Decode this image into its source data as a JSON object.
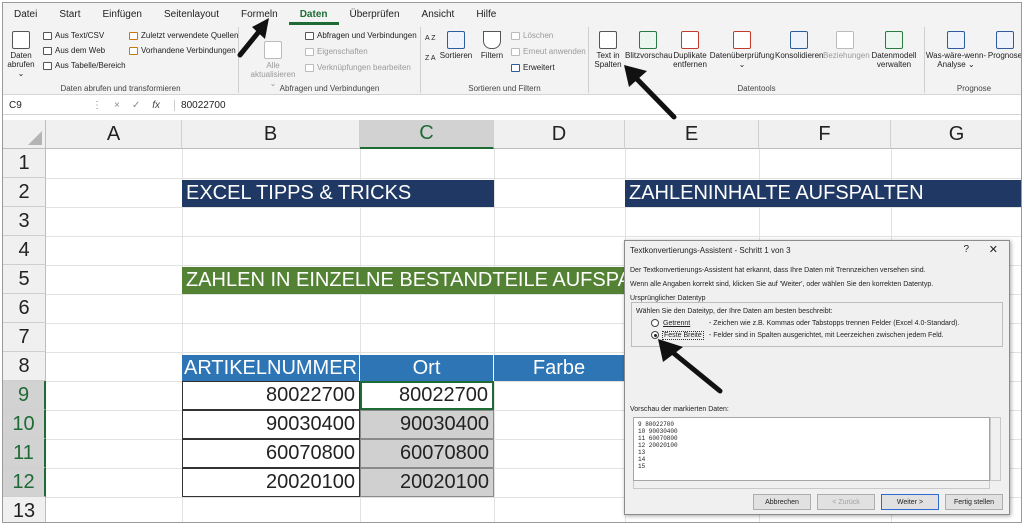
{
  "tabs": [
    "Datei",
    "Start",
    "Einfügen",
    "Seitenlayout",
    "Formeln",
    "Daten",
    "Überprüfen",
    "Ansicht",
    "Hilfe"
  ],
  "active_tab": "Daten",
  "ribbon": {
    "group1": {
      "big_btn_1": "Daten",
      "big_btn_2": "abrufen ⌄",
      "items": [
        "Aus Text/CSV",
        "Aus dem Web",
        "Aus Tabelle/Bereich"
      ],
      "items2": [
        "Zuletzt verwendete Quellen",
        "Vorhandene Verbindungen"
      ],
      "label": "Daten abrufen und transformieren"
    },
    "group2": {
      "big_btn_1": "Alle",
      "big_btn_2": "aktualisieren ⌄",
      "items": [
        "Abfragen und Verbindungen",
        "Eigenschaften",
        "Verknüpfungen bearbeiten"
      ],
      "label": "Abfragen und Verbindungen"
    },
    "group3": {
      "sort_az": "A Z",
      "sort_za": "Z A",
      "sort_btn": "Sortieren",
      "filter_btn": "Filtern",
      "items": [
        "Löschen",
        "Erneut anwenden",
        "Erweitert"
      ],
      "label": "Sortieren und Filtern"
    },
    "group4": {
      "text_in_1": "Text in",
      "text_in_2": "Spalten",
      "blitz": "Blitzvorschau",
      "dup_1": "Duplikate",
      "dup_2": "entfernen",
      "valid_1": "Datenüberprüfung",
      "valid_2": "⌄",
      "konsol": "Konsolidieren",
      "bezieh": "Beziehungen",
      "model_1": "Datenmodell",
      "model_2": "verwalten",
      "label": "Datentools"
    },
    "group5": {
      "wasw_1": "Was-wäre-wenn-",
      "wasw_2": "Analyse ⌄",
      "prog": "Prognose",
      "label": "Prognose"
    }
  },
  "formula_bar": {
    "name_box": "C9",
    "ctrl_more": "⋮",
    "ctrl_cancel": "×",
    "ctrl_enter": "✓",
    "ctrl_fx": "fx",
    "value": "80022700"
  },
  "sheet": {
    "columns": [
      "A",
      "B",
      "C",
      "D",
      "E",
      "F",
      "G"
    ],
    "rows": [
      "1",
      "2",
      "3",
      "4",
      "5",
      "6",
      "7",
      "8",
      "9",
      "10",
      "11",
      "12",
      "13"
    ],
    "banner_b2": "EXCEL TIPPS & TRICKS",
    "banner_e2": "ZAHLENINHALTE AUFSPALTEN",
    "banner_b5": "ZAHLEN IN EINZELNE BESTANDTEILE AUFSPAL",
    "header_b8": "ARTIKELNUMMER",
    "header_c8": "Ort",
    "header_d8": "Farbe",
    "col_b": [
      "80022700",
      "90030400",
      "60070800",
      "20020100"
    ],
    "col_c": [
      "80022700",
      "90030400",
      "60070800",
      "20020100"
    ]
  },
  "dialog": {
    "title": "Textkonvertierungs-Assistent - Schritt 1 von 3",
    "help": "?",
    "close": "✕",
    "line1": "Der Textkonvertierungs-Assistent hat erkannt, dass Ihre Daten mit Trennzeichen versehen sind.",
    "line2": "Wenn alle Angaben korrekt sind, klicken Sie auf 'Weiter', oder wählen Sie den korrekten Datentyp.",
    "section": "Ursprünglicher Datentyp",
    "section_hint": "Wählen Sie den Dateityp, der Ihre Daten am besten beschreibt:",
    "opt1_label": "Getrennt",
    "opt1_desc": "- Zeichen wie z.B. Kommas oder Tabstopps trennen Felder (Excel 4.0-Standard).",
    "opt2_label": "Feste Breite",
    "opt2_desc": "- Felder sind in Spalten ausgerichtet, mit Leerzeichen zwischen jedem Feld.",
    "preview_label": "Vorschau der markierten Daten:",
    "preview_lines": [
      "9 80022700",
      "10 90030400",
      "11 60070800",
      "12 20020100",
      "13",
      "14",
      "15"
    ],
    "btn_cancel": "Abbrechen",
    "btn_back": "< Zurück",
    "btn_next": "Weiter >",
    "btn_finish": "Fertig stellen"
  },
  "colors": {
    "navy_banner": "#1f3864",
    "green_banner": "#548235",
    "table_header": "#2e75b6",
    "excel_green": "#1e6b35"
  }
}
